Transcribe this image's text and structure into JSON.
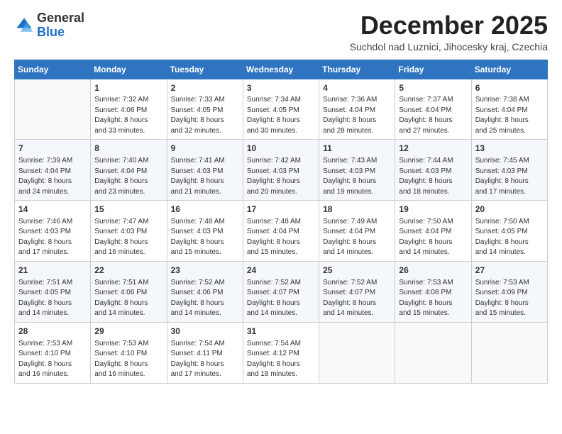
{
  "logo": {
    "general": "General",
    "blue": "Blue"
  },
  "header": {
    "month": "December 2025",
    "location": "Suchdol nad Luznici, Jihocesky kraj, Czechia"
  },
  "weekdays": [
    "Sunday",
    "Monday",
    "Tuesday",
    "Wednesday",
    "Thursday",
    "Friday",
    "Saturday"
  ],
  "weeks": [
    [
      {
        "day": "",
        "info": ""
      },
      {
        "day": "1",
        "info": "Sunrise: 7:32 AM\nSunset: 4:06 PM\nDaylight: 8 hours\nand 33 minutes."
      },
      {
        "day": "2",
        "info": "Sunrise: 7:33 AM\nSunset: 4:05 PM\nDaylight: 8 hours\nand 32 minutes."
      },
      {
        "day": "3",
        "info": "Sunrise: 7:34 AM\nSunset: 4:05 PM\nDaylight: 8 hours\nand 30 minutes."
      },
      {
        "day": "4",
        "info": "Sunrise: 7:36 AM\nSunset: 4:04 PM\nDaylight: 8 hours\nand 28 minutes."
      },
      {
        "day": "5",
        "info": "Sunrise: 7:37 AM\nSunset: 4:04 PM\nDaylight: 8 hours\nand 27 minutes."
      },
      {
        "day": "6",
        "info": "Sunrise: 7:38 AM\nSunset: 4:04 PM\nDaylight: 8 hours\nand 25 minutes."
      }
    ],
    [
      {
        "day": "7",
        "info": "Sunrise: 7:39 AM\nSunset: 4:04 PM\nDaylight: 8 hours\nand 24 minutes."
      },
      {
        "day": "8",
        "info": "Sunrise: 7:40 AM\nSunset: 4:04 PM\nDaylight: 8 hours\nand 23 minutes."
      },
      {
        "day": "9",
        "info": "Sunrise: 7:41 AM\nSunset: 4:03 PM\nDaylight: 8 hours\nand 21 minutes."
      },
      {
        "day": "10",
        "info": "Sunrise: 7:42 AM\nSunset: 4:03 PM\nDaylight: 8 hours\nand 20 minutes."
      },
      {
        "day": "11",
        "info": "Sunrise: 7:43 AM\nSunset: 4:03 PM\nDaylight: 8 hours\nand 19 minutes."
      },
      {
        "day": "12",
        "info": "Sunrise: 7:44 AM\nSunset: 4:03 PM\nDaylight: 8 hours\nand 18 minutes."
      },
      {
        "day": "13",
        "info": "Sunrise: 7:45 AM\nSunset: 4:03 PM\nDaylight: 8 hours\nand 17 minutes."
      }
    ],
    [
      {
        "day": "14",
        "info": "Sunrise: 7:46 AM\nSunset: 4:03 PM\nDaylight: 8 hours\nand 17 minutes."
      },
      {
        "day": "15",
        "info": "Sunrise: 7:47 AM\nSunset: 4:03 PM\nDaylight: 8 hours\nand 16 minutes."
      },
      {
        "day": "16",
        "info": "Sunrise: 7:48 AM\nSunset: 4:03 PM\nDaylight: 8 hours\nand 15 minutes."
      },
      {
        "day": "17",
        "info": "Sunrise: 7:48 AM\nSunset: 4:04 PM\nDaylight: 8 hours\nand 15 minutes."
      },
      {
        "day": "18",
        "info": "Sunrise: 7:49 AM\nSunset: 4:04 PM\nDaylight: 8 hours\nand 14 minutes."
      },
      {
        "day": "19",
        "info": "Sunrise: 7:50 AM\nSunset: 4:04 PM\nDaylight: 8 hours\nand 14 minutes."
      },
      {
        "day": "20",
        "info": "Sunrise: 7:50 AM\nSunset: 4:05 PM\nDaylight: 8 hours\nand 14 minutes."
      }
    ],
    [
      {
        "day": "21",
        "info": "Sunrise: 7:51 AM\nSunset: 4:05 PM\nDaylight: 8 hours\nand 14 minutes."
      },
      {
        "day": "22",
        "info": "Sunrise: 7:51 AM\nSunset: 4:06 PM\nDaylight: 8 hours\nand 14 minutes."
      },
      {
        "day": "23",
        "info": "Sunrise: 7:52 AM\nSunset: 4:06 PM\nDaylight: 8 hours\nand 14 minutes."
      },
      {
        "day": "24",
        "info": "Sunrise: 7:52 AM\nSunset: 4:07 PM\nDaylight: 8 hours\nand 14 minutes."
      },
      {
        "day": "25",
        "info": "Sunrise: 7:52 AM\nSunset: 4:07 PM\nDaylight: 8 hours\nand 14 minutes."
      },
      {
        "day": "26",
        "info": "Sunrise: 7:53 AM\nSunset: 4:08 PM\nDaylight: 8 hours\nand 15 minutes."
      },
      {
        "day": "27",
        "info": "Sunrise: 7:53 AM\nSunset: 4:09 PM\nDaylight: 8 hours\nand 15 minutes."
      }
    ],
    [
      {
        "day": "28",
        "info": "Sunrise: 7:53 AM\nSunset: 4:10 PM\nDaylight: 8 hours\nand 16 minutes."
      },
      {
        "day": "29",
        "info": "Sunrise: 7:53 AM\nSunset: 4:10 PM\nDaylight: 8 hours\nand 16 minutes."
      },
      {
        "day": "30",
        "info": "Sunrise: 7:54 AM\nSunset: 4:11 PM\nDaylight: 8 hours\nand 17 minutes."
      },
      {
        "day": "31",
        "info": "Sunrise: 7:54 AM\nSunset: 4:12 PM\nDaylight: 8 hours\nand 18 minutes."
      },
      {
        "day": "",
        "info": ""
      },
      {
        "day": "",
        "info": ""
      },
      {
        "day": "",
        "info": ""
      }
    ]
  ]
}
